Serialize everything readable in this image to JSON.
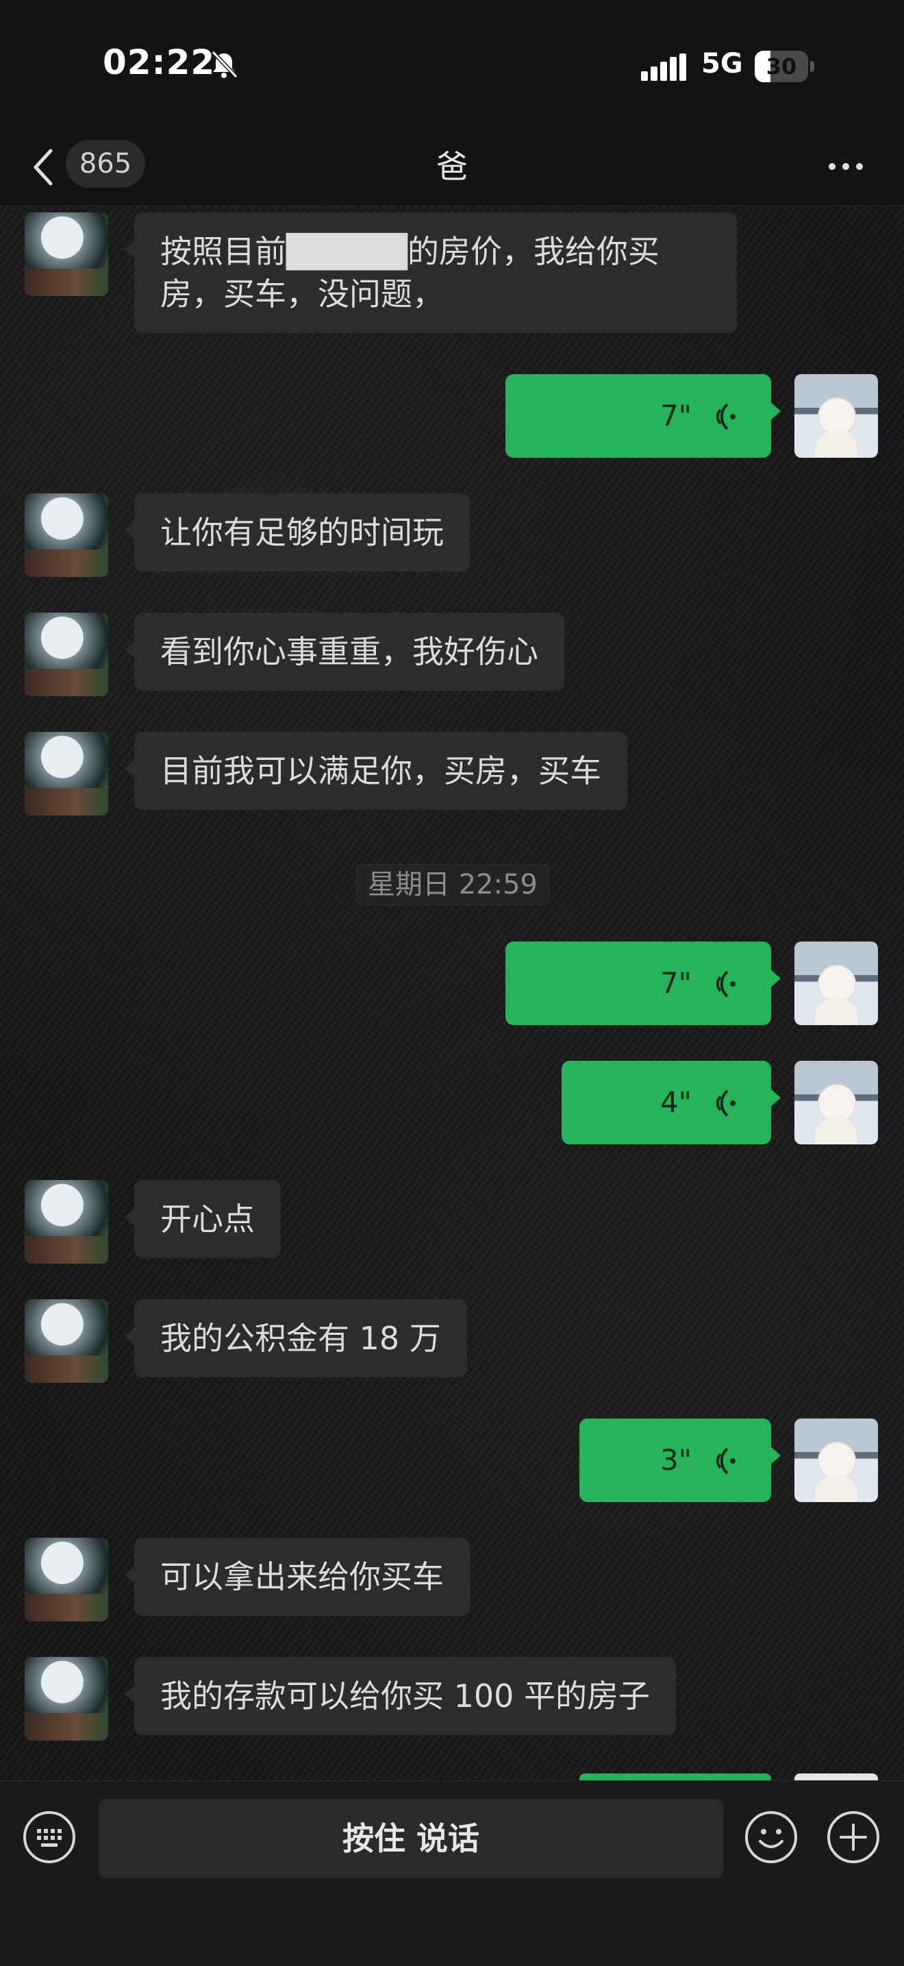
{
  "status_bar": {
    "time": "02:22",
    "network": "5G",
    "battery": "30",
    "battery_level": 0.3
  },
  "nav": {
    "unread_count": "865",
    "title": "爸"
  },
  "messages": [
    {
      "side": "left",
      "type": "text",
      "text": "按照目前█████的房价，我给你买房，买车，没问题，",
      "note": "partially redacted"
    },
    {
      "side": "right",
      "type": "voice",
      "duration": "7\""
    },
    {
      "side": "left",
      "type": "text",
      "text": "让你有足够的时间玩"
    },
    {
      "side": "left",
      "type": "text",
      "text": "看到你心事重重，我好伤心"
    },
    {
      "side": "left",
      "type": "text",
      "text": "目前我可以满足你，买房，买车"
    },
    {
      "type": "timestamp",
      "text": "星期日 22:59"
    },
    {
      "side": "right",
      "type": "voice",
      "duration": "7\""
    },
    {
      "side": "right",
      "type": "voice",
      "duration": "4\""
    },
    {
      "side": "left",
      "type": "text",
      "text": "开心点"
    },
    {
      "side": "left",
      "type": "text",
      "text": "我的公积金有 18 万"
    },
    {
      "side": "right",
      "type": "voice",
      "duration": "3\""
    },
    {
      "side": "left",
      "type": "text",
      "text": "可以拿出来给你买车"
    },
    {
      "side": "left",
      "type": "text",
      "text": "我的存款可以给你买 100 平的房子"
    }
  ],
  "input_bar": {
    "hold_to_talk": "按住 说话"
  },
  "icons": {
    "mute": "bell-slash-icon",
    "signal": "signal-icon",
    "back": "chevron-left-icon",
    "more": "more-dots-icon",
    "voice": "voice-wave-icon",
    "keyboard": "keyboard-icon",
    "emoji": "emoji-icon",
    "plus": "plus-icon"
  },
  "colors": {
    "voice_bubble": "#26b45a",
    "text_bubble": "#2c2c2c",
    "background": "#1a1a1a"
  }
}
